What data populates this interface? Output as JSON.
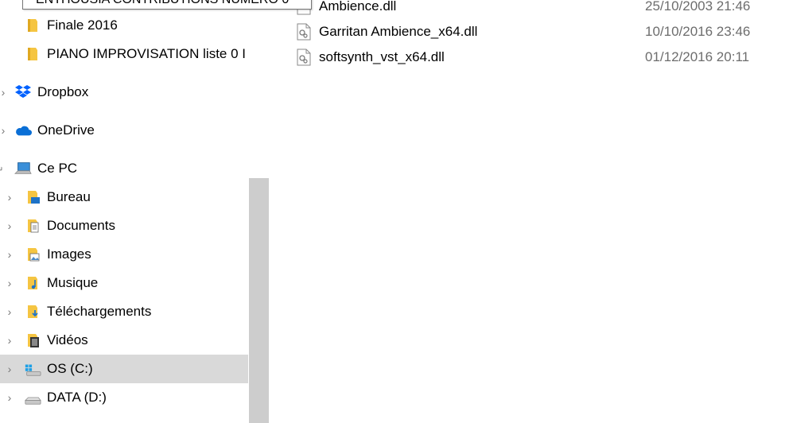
{
  "tooltip": {
    "text": "ENTHOUSIA CONTRIBUTIONS NUMERO 0"
  },
  "nav": {
    "quick_items": [
      {
        "label": "Finale 2016"
      },
      {
        "label": "PIANO IMPROVISATION liste 0 I"
      }
    ],
    "dropbox": {
      "label": "Dropbox"
    },
    "onedrive": {
      "label": "OneDrive"
    },
    "this_pc": {
      "label": "Ce PC"
    },
    "pc_items": [
      {
        "label": "Bureau"
      },
      {
        "label": "Documents"
      },
      {
        "label": "Images"
      },
      {
        "label": "Musique"
      },
      {
        "label": "Téléchargements"
      },
      {
        "label": "Vidéos"
      },
      {
        "label": "OS (C:)"
      },
      {
        "label": "DATA (D:)"
      }
    ]
  },
  "files": [
    {
      "name": "Ambience.dll",
      "date": "25/10/2003 21:46"
    },
    {
      "name": "Garritan Ambience_x64.dll",
      "date": "10/10/2016 23:46"
    },
    {
      "name": "softsynth_vst_x64.dll",
      "date": "01/12/2016 20:11"
    }
  ],
  "colors": {
    "folder": "#f5c542",
    "selected_row": "#d9d9d9",
    "dropbox_blue": "#0061fe",
    "onedrive_blue": "#0a6fd6",
    "date_gray": "#6d6d6d"
  }
}
